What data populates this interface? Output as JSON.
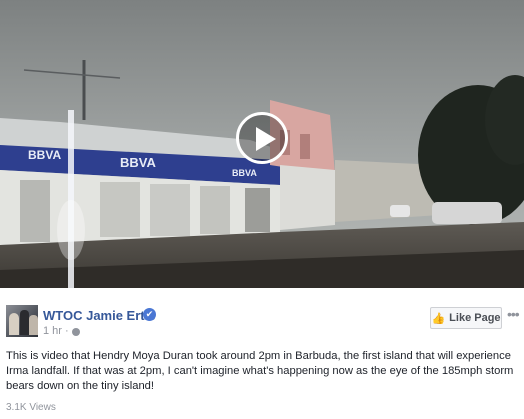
{
  "video": {
    "bank_signs": [
      "BBVA",
      "BBVA",
      "BBVA"
    ],
    "play_icon": "play-icon"
  },
  "post": {
    "page_name": "WTOC Jamie Ertle",
    "verified_icon": "✔",
    "time": "1 hr ·",
    "like_button_label": "Like Page",
    "more_options": "•••",
    "text": "This is video that Hendry Moya Duran took around 2pm in Barbuda, the first island that will experience Irma landfall. If that was at 2pm, I can't imagine what's happening now as the eye of the 185mph storm bears down on the tiny island!",
    "views": "3.1K Views"
  },
  "colors": {
    "link_blue": "#365899",
    "meta_gray": "#90949c",
    "verified_blue": "#4a77d4"
  }
}
